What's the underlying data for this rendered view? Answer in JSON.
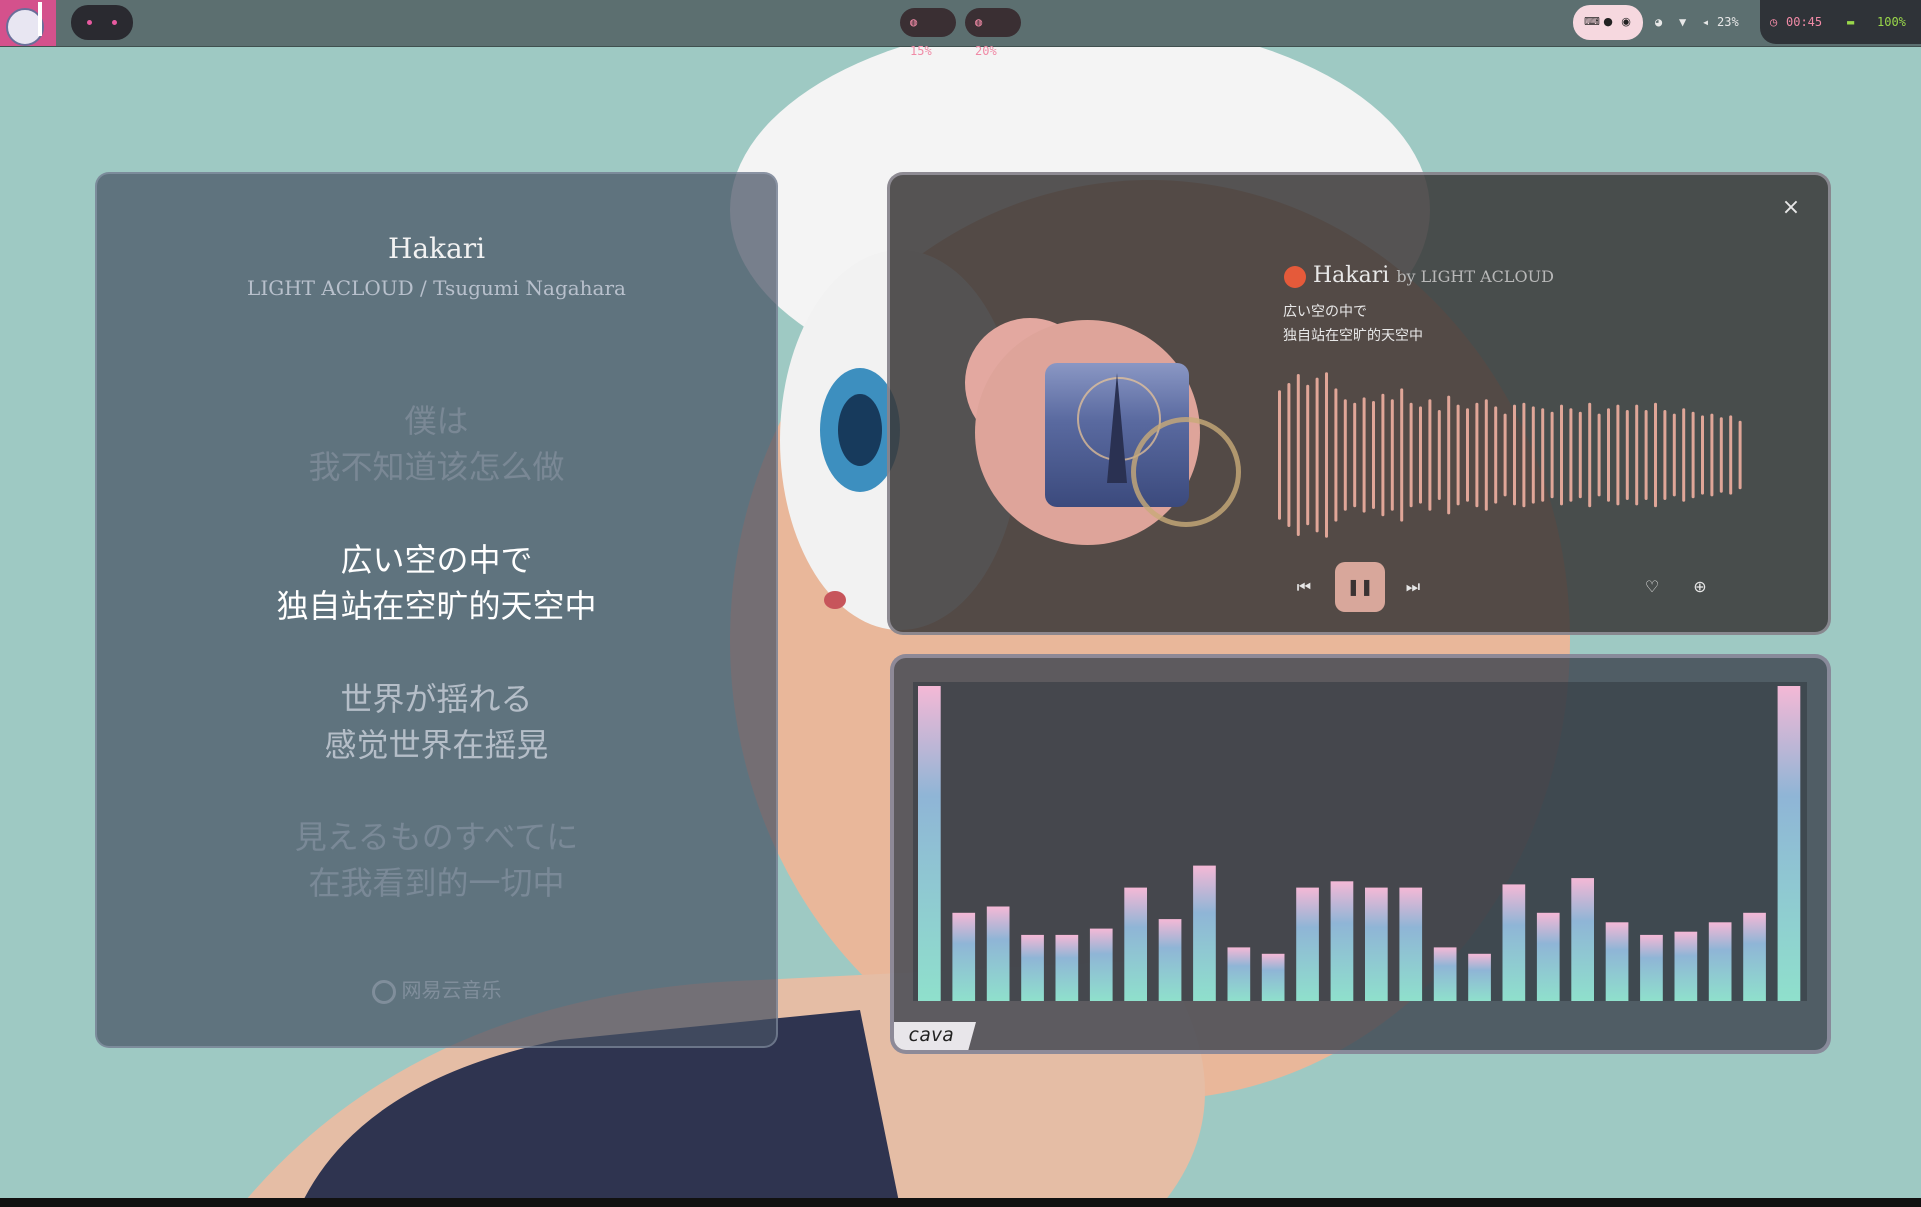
{
  "topbar": {
    "cpu": "15%",
    "mem": "20%",
    "volume": "23%",
    "clock": "00:45",
    "battery": "100%",
    "icons": [
      "keyboard-icon",
      "linux-icon",
      "record-icon",
      "palette-icon",
      "wifi-icon",
      "volume-icon",
      "clock-icon",
      "battery-icon"
    ]
  },
  "lyrics_panel": {
    "title": "Hakari",
    "artist": "LIGHT ACLOUD / Tsugumi Nagahara",
    "lines": [
      {
        "jp": "僕は",
        "cn": "我不知道该怎么做",
        "state": "dim"
      },
      {
        "jp": "広い空の中で",
        "cn": "独自站在空旷的天空中",
        "state": "active"
      },
      {
        "jp": "世界が揺れる",
        "cn": "感觉世界在摇晃",
        "state": "near"
      },
      {
        "jp": "見えるものすべてに",
        "cn": "在我看到的一切中",
        "state": "far"
      }
    ],
    "brand": "网易云音乐"
  },
  "player": {
    "title": "Hakari",
    "by": "by LIGHT ACLOUD",
    "line1": "広い空の中で",
    "line2": "独自站在空旷的天空中",
    "close_icon": "×",
    "progress_waveform_heights": [
      0.72,
      0.8,
      0.9,
      0.78,
      0.86,
      0.92,
      0.74,
      0.62,
      0.58,
      0.64,
      0.6,
      0.68,
      0.62,
      0.74,
      0.58,
      0.54,
      0.62,
      0.5,
      0.66,
      0.56,
      0.52,
      0.58,
      0.62,
      0.54,
      0.46,
      0.56,
      0.58,
      0.54,
      0.52,
      0.48,
      0.56,
      0.52,
      0.48,
      0.58,
      0.46,
      0.52,
      0.56,
      0.5,
      0.56,
      0.5,
      0.58,
      0.5,
      0.46,
      0.52,
      0.48,
      0.44,
      0.46,
      0.42,
      0.44,
      0.38
    ]
  },
  "cava": {
    "label": "cava",
    "bars": [
      1.0,
      0.28,
      0.3,
      0.21,
      0.21,
      0.23,
      0.36,
      0.26,
      0.43,
      0.17,
      0.15,
      0.36,
      0.38,
      0.36,
      0.36,
      0.17,
      0.15,
      0.37,
      0.28,
      0.39,
      0.25,
      0.21,
      0.22,
      0.25,
      0.28,
      1.0
    ]
  }
}
